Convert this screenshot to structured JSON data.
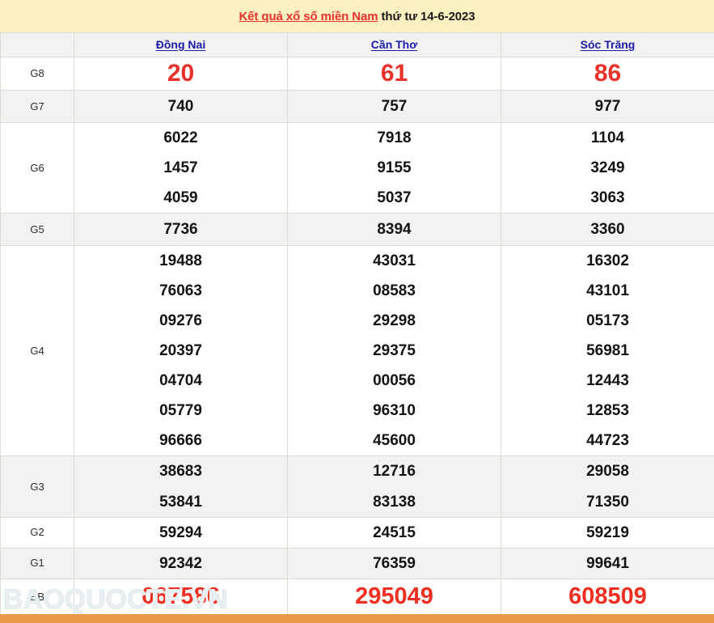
{
  "title": {
    "highlight": "Kết quả xổ số miền Nam",
    "rest": " thứ tư 14-6-2023",
    "accent_color": "#e8312a",
    "bar_color": "#fcefc1"
  },
  "table": {
    "corner_label": "",
    "provinces": [
      "Đồng Nai",
      "Cần Thơ",
      "Sóc Trăng"
    ],
    "prize_color_red": "#e8312a",
    "prize_color_black": "#141414",
    "rows": [
      {
        "label": "G8",
        "style": "big-red",
        "values": {
          "dong_nai": [
            "20"
          ],
          "can_tho": [
            "61"
          ],
          "soc_trang": [
            "86"
          ]
        }
      },
      {
        "label": "G7",
        "style": "normal",
        "values": {
          "dong_nai": [
            "740"
          ],
          "can_tho": [
            "757"
          ],
          "soc_trang": [
            "977"
          ]
        }
      },
      {
        "label": "G6",
        "style": "normal",
        "values": {
          "dong_nai": [
            "6022",
            "1457",
            "4059"
          ],
          "can_tho": [
            "7918",
            "9155",
            "5037"
          ],
          "soc_trang": [
            "1104",
            "3249",
            "3063"
          ]
        }
      },
      {
        "label": "G5",
        "style": "normal",
        "values": {
          "dong_nai": [
            "7736"
          ],
          "can_tho": [
            "8394"
          ],
          "soc_trang": [
            "3360"
          ]
        }
      },
      {
        "label": "G4",
        "style": "normal",
        "values": {
          "dong_nai": [
            "19488",
            "76063",
            "09276",
            "20397",
            "04704",
            "05779",
            "96666"
          ],
          "can_tho": [
            "43031",
            "08583",
            "29298",
            "29375",
            "00056",
            "96310",
            "45600"
          ],
          "soc_trang": [
            "16302",
            "43101",
            "05173",
            "56981",
            "12443",
            "12853",
            "44723"
          ]
        }
      },
      {
        "label": "G3",
        "style": "normal",
        "values": {
          "dong_nai": [
            "38683",
            "53841"
          ],
          "can_tho": [
            "12716",
            "83138"
          ],
          "soc_trang": [
            "29058",
            "71350"
          ]
        }
      },
      {
        "label": "G2",
        "style": "normal",
        "values": {
          "dong_nai": [
            "59294"
          ],
          "can_tho": [
            "24515"
          ],
          "soc_trang": [
            "59219"
          ]
        }
      },
      {
        "label": "G1",
        "style": "normal",
        "values": {
          "dong_nai": [
            "92342"
          ],
          "can_tho": [
            "76359"
          ],
          "soc_trang": [
            "99641"
          ]
        }
      },
      {
        "label": "ĐB",
        "style": "db-red",
        "values": {
          "dong_nai": [
            "067586"
          ],
          "can_tho": [
            "295049"
          ],
          "soc_trang": [
            "608509"
          ]
        }
      }
    ]
  },
  "watermark": {
    "text": "BAOQUOCTE.VN"
  },
  "bottom_bar": {
    "left_text": "",
    "right_text": "",
    "color": "#ed9a48"
  }
}
